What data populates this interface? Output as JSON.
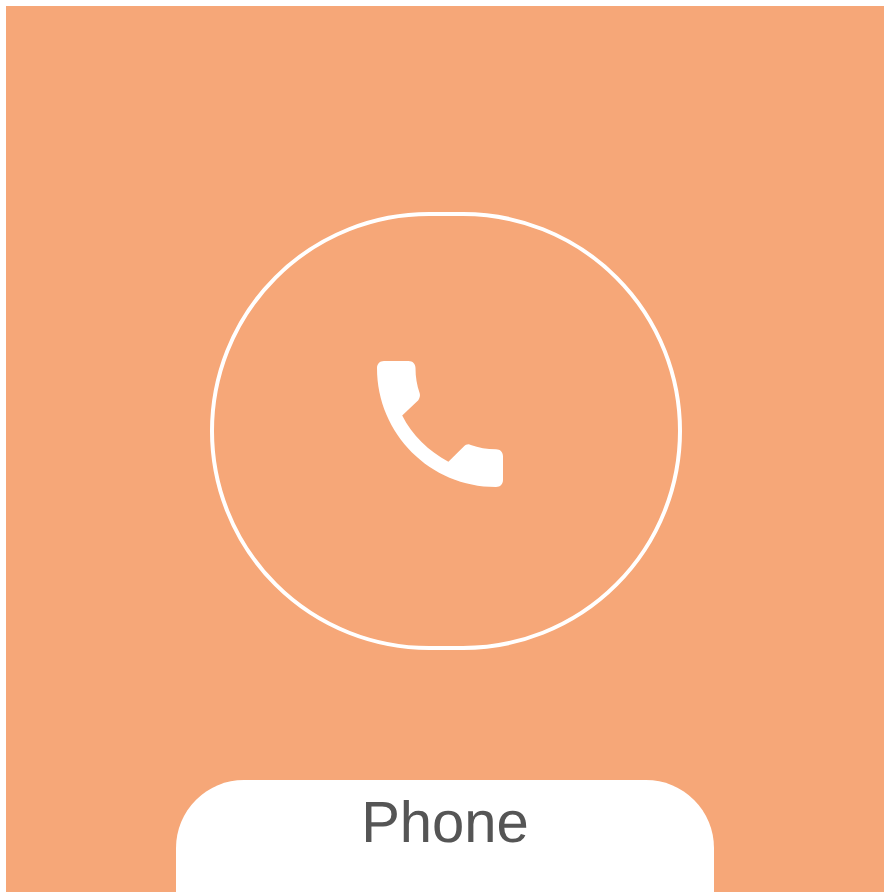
{
  "tile": {
    "label": "Phone"
  }
}
